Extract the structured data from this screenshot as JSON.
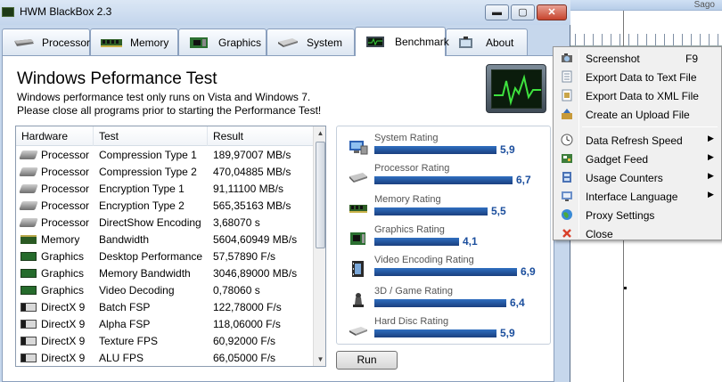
{
  "window": {
    "title": "HWM BlackBox 2.3",
    "minimize": "▬",
    "maximize": "▢",
    "close": "✕"
  },
  "background_window": {
    "label": "Sago"
  },
  "tabs": [
    {
      "label": "Processor"
    },
    {
      "label": "Memory"
    },
    {
      "label": "Graphics"
    },
    {
      "label": "System"
    },
    {
      "label": "Benchmark",
      "active": true
    },
    {
      "label": "About"
    }
  ],
  "benchmark": {
    "title": "Windows Peformance Test",
    "line1": "Windows performance test only runs on Vista and Windows 7.",
    "line2": "Please close all programs prior to starting the Performance Test!",
    "columns": {
      "hardware": "Hardware",
      "test": "Test",
      "result": "Result"
    },
    "rows": [
      {
        "hw": "Processor",
        "icon": "processor-icon",
        "test": "Compression Type 1",
        "result": "189,97007 MB/s"
      },
      {
        "hw": "Processor",
        "icon": "processor-icon",
        "test": "Compression Type 2",
        "result": "470,04885 MB/s"
      },
      {
        "hw": "Processor",
        "icon": "processor-icon",
        "test": "Encryption Type 1",
        "result": "91,11100 MB/s"
      },
      {
        "hw": "Processor",
        "icon": "processor-icon",
        "test": "Encryption Type 2",
        "result": "565,35163 MB/s"
      },
      {
        "hw": "Processor",
        "icon": "processor-icon",
        "test": "DirectShow Encoding",
        "result": "3,68070 s"
      },
      {
        "hw": "Memory",
        "icon": "memory-icon",
        "test": "Bandwidth",
        "result": "5604,60949 MB/s"
      },
      {
        "hw": "Graphics",
        "icon": "graphics-card-icon",
        "test": "Desktop Performance",
        "result": "57,57890 F/s"
      },
      {
        "hw": "Graphics",
        "icon": "graphics-card-icon",
        "test": "Memory Bandwidth",
        "result": "3046,89000 MB/s"
      },
      {
        "hw": "Graphics",
        "icon": "graphics-card-icon",
        "test": "Video Decoding",
        "result": "0,78060 s"
      },
      {
        "hw": "DirectX 9",
        "icon": "directx-icon",
        "test": "Batch FSP",
        "result": "122,78000 F/s"
      },
      {
        "hw": "DirectX 9",
        "icon": "directx-icon",
        "test": "Alpha FSP",
        "result": "118,06000 F/s"
      },
      {
        "hw": "DirectX 9",
        "icon": "directx-icon",
        "test": "Texture FPS",
        "result": "60,92000 F/s"
      },
      {
        "hw": "DirectX 9",
        "icon": "directx-icon",
        "test": "ALU FPS",
        "result": "66,05000 F/s"
      }
    ],
    "ratings": [
      {
        "label": "System Rating",
        "value": "5,9",
        "level": 5.9,
        "icon": "system-icon"
      },
      {
        "label": "Processor Rating",
        "value": "6,7",
        "level": 6.7,
        "icon": "processor-icon"
      },
      {
        "label": "Memory Rating",
        "value": "5,5",
        "level": 5.5,
        "icon": "memory-icon"
      },
      {
        "label": "Graphics Rating",
        "value": "4,1",
        "level": 4.1,
        "icon": "graphics-card-icon"
      },
      {
        "label": "Video Encoding Rating",
        "value": "6,9",
        "level": 6.9,
        "icon": "film-icon"
      },
      {
        "label": "3D / Game Rating",
        "value": "6,4",
        "level": 6.4,
        "icon": "chess-piece-icon"
      },
      {
        "label": "Hard Disc Rating",
        "value": "5,9",
        "level": 5.9,
        "icon": "hard-disk-icon"
      }
    ],
    "rating_max": 7.0,
    "run_label": "Run"
  },
  "context_menu": {
    "items": [
      {
        "label": "Screenshot",
        "shortcut": "F9",
        "icon": "camera-icon"
      },
      {
        "label": "Export Data to Text File",
        "icon": "text-file-icon"
      },
      {
        "label": "Export Data to XML File",
        "icon": "xml-file-icon"
      },
      {
        "label": "Create an Upload File",
        "icon": "upload-icon"
      },
      {
        "separator": true
      },
      {
        "label": "Data Refresh Speed",
        "submenu": true,
        "icon": "clock-icon"
      },
      {
        "label": "Gadget Feed",
        "submenu": true,
        "icon": "gadget-icon"
      },
      {
        "label": "Usage Counters",
        "submenu": true,
        "icon": "gauge-icon"
      },
      {
        "label": "Interface Language",
        "submenu": true,
        "icon": "language-icon"
      },
      {
        "label": "Proxy Settings",
        "icon": "globe-icon"
      },
      {
        "label": "Close",
        "icon": "close-icon"
      }
    ]
  },
  "colors": {
    "rating_bar": "#1f4f97",
    "rating_value": "#1b4e9d",
    "titlebar": "#c6d7ec"
  }
}
